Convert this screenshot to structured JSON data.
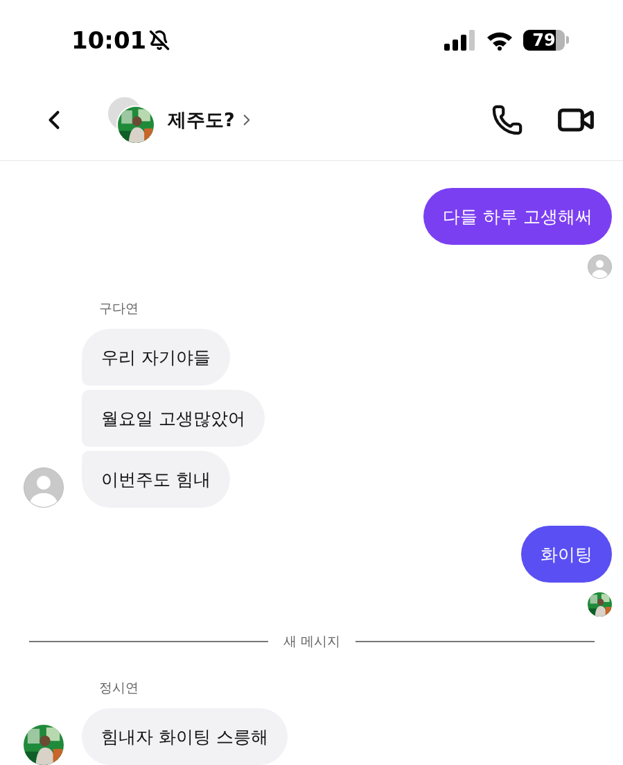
{
  "status_bar": {
    "time": "10:01",
    "silenced": true,
    "battery": "79"
  },
  "header": {
    "title": "제주도?"
  },
  "messages": [
    {
      "kind": "outgoing",
      "text": "다들 하루 고생해써",
      "color": "#7b3ff2"
    },
    {
      "kind": "receipt",
      "avatar": {
        "kind": "default"
      }
    },
    {
      "kind": "sender",
      "text": "구다연"
    },
    {
      "kind": "incoming",
      "text": "우리 자기야들",
      "joined_above": false,
      "joined_below": true
    },
    {
      "kind": "incoming",
      "text": "월요일 고생많았어",
      "joined_above": true,
      "joined_below": true
    },
    {
      "kind": "incoming",
      "text": "이번주도 힘내",
      "joined_above": true,
      "joined_below": false,
      "avatar": {
        "kind": "default"
      }
    },
    {
      "kind": "outgoing",
      "text": "화이팅",
      "color": "#5a4ff3"
    },
    {
      "kind": "receipt"
    },
    {
      "kind": "divider",
      "text": "새 메시지"
    },
    {
      "kind": "sender",
      "text": "정시연"
    },
    {
      "kind": "incoming",
      "text": "힘내자 화이팅 스릉해",
      "joined_above": false,
      "joined_below": false
    }
  ]
}
